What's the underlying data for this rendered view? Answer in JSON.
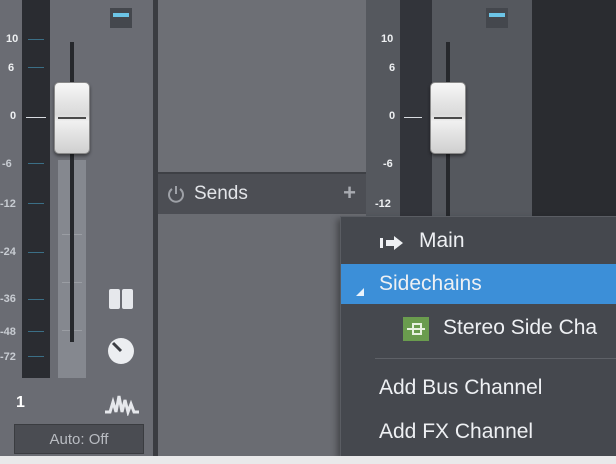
{
  "colors": {
    "accent": "#3c8fd8",
    "led": "#6cc4e6",
    "sidechain_icon": "#6a9c4e"
  },
  "channel1": {
    "scale_labels": [
      "10",
      "6",
      "0",
      "-6",
      "-12",
      "-24",
      "-36",
      "-48",
      "-72"
    ],
    "number": "1",
    "automation": "Auto: Off",
    "icons": [
      "stereo-link-icon",
      "pan-knob-icon",
      "waveform-icon"
    ]
  },
  "channel2": {
    "scale_labels": [
      "10",
      "6",
      "0",
      "-6",
      "-12"
    ]
  },
  "sends": {
    "label": "Sends",
    "power_icon": "power-icon",
    "add_icon": "plus-icon"
  },
  "menu": {
    "items": [
      {
        "label": "Main",
        "icon": "route-arrow-icon",
        "selected": false
      },
      {
        "label": "Sidechains",
        "icon": "triangle-expand-icon",
        "selected": true
      },
      {
        "label": "Stereo Side Cha",
        "icon": "sidechain-plugin-icon",
        "selected": false
      },
      {
        "label": "Add Bus Channel",
        "selected": false
      },
      {
        "label": "Add FX Channel",
        "selected": false
      }
    ]
  }
}
